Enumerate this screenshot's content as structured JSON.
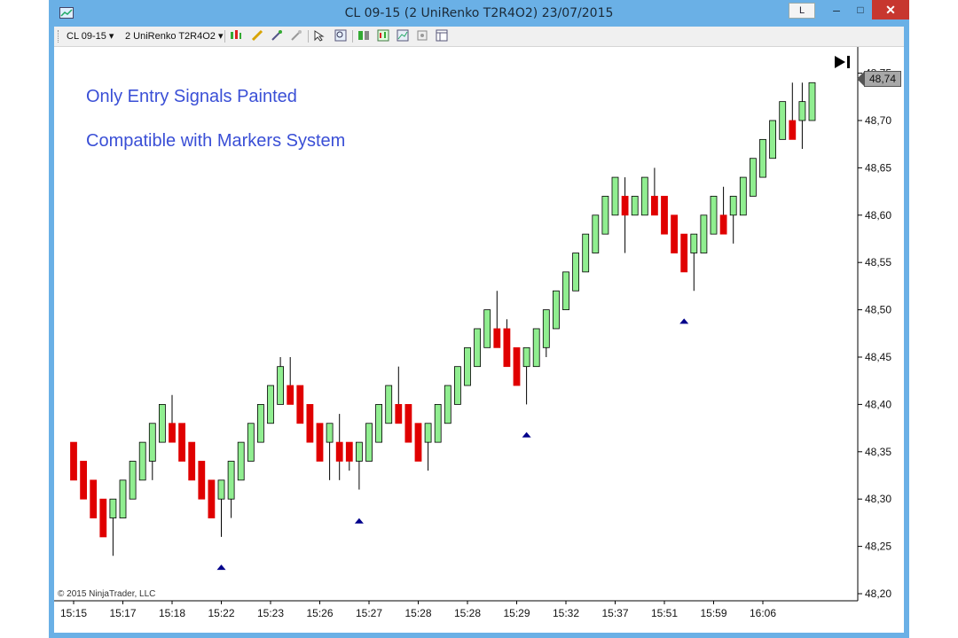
{
  "window": {
    "title": "CL 09-15 (2 UniRenko T2R4O2)  23/07/2015",
    "btn_l": "L",
    "btn_min": "–",
    "btn_max": "□",
    "btn_close": "✕"
  },
  "toolbar": {
    "instrument": "CL 09-15 ▾",
    "period": "2 UniRenko T2R4O2 ▾",
    "icons": [
      "bar-style-icon",
      "draw-pencil-icon",
      "indicator-add-icon",
      "strategy-icon",
      "cursor-select-icon",
      "zoom-icon",
      "data-box-icon",
      "chart-trader-icon",
      "properties-icon",
      "screenshot-icon",
      "template-icon"
    ]
  },
  "notes": {
    "line1": "Only Entry Signals Painted",
    "line2": "Compatible with Markers System"
  },
  "copyright": "© 2015 NinjaTrader, LLC",
  "price_tag": "48,74",
  "colors": {
    "up": "#90ee90",
    "down": "#e00000",
    "marker": "#00008b",
    "accent": "#3a4fd6"
  },
  "chart_data": {
    "type": "candlestick",
    "title": "",
    "ylim": [
      48.2,
      48.76
    ],
    "y_ticks": [
      "48,20",
      "48,25",
      "48,30",
      "48,35",
      "48,40",
      "48,45",
      "48,50",
      "48,55",
      "48,60",
      "48,65",
      "48,70",
      "48,75"
    ],
    "x_tick_labels": [
      "15:15",
      "15:17",
      "15:18",
      "15:22",
      "15:23",
      "15:26",
      "15:27",
      "15:28",
      "15:28",
      "15:29",
      "15:32",
      "15:37",
      "15:51",
      "15:59",
      "16:06"
    ],
    "candles": [
      {
        "o": 48.36,
        "c": 48.32,
        "h": 48.36,
        "l": 48.32
      },
      {
        "o": 48.34,
        "c": 48.3,
        "h": 48.34,
        "l": 48.3
      },
      {
        "o": 48.32,
        "c": 48.28,
        "h": 48.32,
        "l": 48.28
      },
      {
        "o": 48.3,
        "c": 48.26,
        "h": 48.3,
        "l": 48.26
      },
      {
        "o": 48.28,
        "c": 48.3,
        "h": 48.3,
        "l": 48.24
      },
      {
        "o": 48.28,
        "c": 48.32,
        "h": 48.32,
        "l": 48.28
      },
      {
        "o": 48.3,
        "c": 48.34,
        "h": 48.34,
        "l": 48.3
      },
      {
        "o": 48.32,
        "c": 48.36,
        "h": 48.36,
        "l": 48.32
      },
      {
        "o": 48.34,
        "c": 48.38,
        "h": 48.38,
        "l": 48.32
      },
      {
        "o": 48.36,
        "c": 48.4,
        "h": 48.4,
        "l": 48.36
      },
      {
        "o": 48.38,
        "c": 48.36,
        "h": 48.41,
        "l": 48.36
      },
      {
        "o": 48.38,
        "c": 48.34,
        "h": 48.38,
        "l": 48.34
      },
      {
        "o": 48.36,
        "c": 48.32,
        "h": 48.36,
        "l": 48.32
      },
      {
        "o": 48.34,
        "c": 48.3,
        "h": 48.34,
        "l": 48.3
      },
      {
        "o": 48.32,
        "c": 48.28,
        "h": 48.32,
        "l": 48.28
      },
      {
        "o": 48.3,
        "c": 48.32,
        "h": 48.32,
        "l": 48.26
      },
      {
        "o": 48.3,
        "c": 48.34,
        "h": 48.34,
        "l": 48.28
      },
      {
        "o": 48.32,
        "c": 48.36,
        "h": 48.36,
        "l": 48.32
      },
      {
        "o": 48.34,
        "c": 48.38,
        "h": 48.38,
        "l": 48.34
      },
      {
        "o": 48.36,
        "c": 48.4,
        "h": 48.4,
        "l": 48.36
      },
      {
        "o": 48.38,
        "c": 48.42,
        "h": 48.42,
        "l": 48.38
      },
      {
        "o": 48.4,
        "c": 48.44,
        "h": 48.45,
        "l": 48.4
      },
      {
        "o": 48.42,
        "c": 48.4,
        "h": 48.45,
        "l": 48.4
      },
      {
        "o": 48.42,
        "c": 48.38,
        "h": 48.42,
        "l": 48.38
      },
      {
        "o": 48.4,
        "c": 48.36,
        "h": 48.4,
        "l": 48.36
      },
      {
        "o": 48.38,
        "c": 48.34,
        "h": 48.38,
        "l": 48.34
      },
      {
        "o": 48.36,
        "c": 48.38,
        "h": 48.38,
        "l": 48.32
      },
      {
        "o": 48.36,
        "c": 48.34,
        "h": 48.39,
        "l": 48.32
      },
      {
        "o": 48.36,
        "c": 48.34,
        "h": 48.36,
        "l": 48.33
      },
      {
        "o": 48.34,
        "c": 48.36,
        "h": 48.36,
        "l": 48.31
      },
      {
        "o": 48.34,
        "c": 48.38,
        "h": 48.38,
        "l": 48.34
      },
      {
        "o": 48.36,
        "c": 48.4,
        "h": 48.4,
        "l": 48.36
      },
      {
        "o": 48.38,
        "c": 48.42,
        "h": 48.42,
        "l": 48.38
      },
      {
        "o": 48.4,
        "c": 48.38,
        "h": 48.44,
        "l": 48.38
      },
      {
        "o": 48.4,
        "c": 48.36,
        "h": 48.4,
        "l": 48.36
      },
      {
        "o": 48.38,
        "c": 48.34,
        "h": 48.38,
        "l": 48.34
      },
      {
        "o": 48.36,
        "c": 48.38,
        "h": 48.38,
        "l": 48.33
      },
      {
        "o": 48.36,
        "c": 48.4,
        "h": 48.4,
        "l": 48.36
      },
      {
        "o": 48.38,
        "c": 48.42,
        "h": 48.42,
        "l": 48.38
      },
      {
        "o": 48.4,
        "c": 48.44,
        "h": 48.44,
        "l": 48.4
      },
      {
        "o": 48.42,
        "c": 48.46,
        "h": 48.46,
        "l": 48.42
      },
      {
        "o": 48.44,
        "c": 48.48,
        "h": 48.48,
        "l": 48.44
      },
      {
        "o": 48.46,
        "c": 48.5,
        "h": 48.5,
        "l": 48.46
      },
      {
        "o": 48.48,
        "c": 48.46,
        "h": 48.52,
        "l": 48.46
      },
      {
        "o": 48.48,
        "c": 48.44,
        "h": 48.49,
        "l": 48.44
      },
      {
        "o": 48.46,
        "c": 48.42,
        "h": 48.46,
        "l": 48.42
      },
      {
        "o": 48.44,
        "c": 48.46,
        "h": 48.46,
        "l": 48.4
      },
      {
        "o": 48.44,
        "c": 48.48,
        "h": 48.48,
        "l": 48.44
      },
      {
        "o": 48.46,
        "c": 48.5,
        "h": 48.5,
        "l": 48.45
      },
      {
        "o": 48.48,
        "c": 48.52,
        "h": 48.52,
        "l": 48.48
      },
      {
        "o": 48.5,
        "c": 48.54,
        "h": 48.54,
        "l": 48.5
      },
      {
        "o": 48.52,
        "c": 48.56,
        "h": 48.56,
        "l": 48.52
      },
      {
        "o": 48.54,
        "c": 48.58,
        "h": 48.58,
        "l": 48.54
      },
      {
        "o": 48.56,
        "c": 48.6,
        "h": 48.6,
        "l": 48.56
      },
      {
        "o": 48.58,
        "c": 48.62,
        "h": 48.62,
        "l": 48.58
      },
      {
        "o": 48.6,
        "c": 48.64,
        "h": 48.64,
        "l": 48.6
      },
      {
        "o": 48.62,
        "c": 48.6,
        "h": 48.64,
        "l": 48.56
      },
      {
        "o": 48.6,
        "c": 48.62,
        "h": 48.62,
        "l": 48.6
      },
      {
        "o": 48.6,
        "c": 48.64,
        "h": 48.64,
        "l": 48.6
      },
      {
        "o": 48.62,
        "c": 48.6,
        "h": 48.65,
        "l": 48.6
      },
      {
        "o": 48.62,
        "c": 48.58,
        "h": 48.62,
        "l": 48.58
      },
      {
        "o": 48.6,
        "c": 48.56,
        "h": 48.6,
        "l": 48.56
      },
      {
        "o": 48.58,
        "c": 48.54,
        "h": 48.58,
        "l": 48.54
      },
      {
        "o": 48.56,
        "c": 48.58,
        "h": 48.58,
        "l": 48.52
      },
      {
        "o": 48.56,
        "c": 48.6,
        "h": 48.6,
        "l": 48.56
      },
      {
        "o": 48.58,
        "c": 48.62,
        "h": 48.62,
        "l": 48.58
      },
      {
        "o": 48.6,
        "c": 48.58,
        "h": 48.63,
        "l": 48.58
      },
      {
        "o": 48.6,
        "c": 48.62,
        "h": 48.62,
        "l": 48.57
      },
      {
        "o": 48.6,
        "c": 48.64,
        "h": 48.64,
        "l": 48.6
      },
      {
        "o": 48.62,
        "c": 48.66,
        "h": 48.66,
        "l": 48.62
      },
      {
        "o": 48.64,
        "c": 48.68,
        "h": 48.68,
        "l": 48.64
      },
      {
        "o": 48.66,
        "c": 48.7,
        "h": 48.7,
        "l": 48.66
      },
      {
        "o": 48.68,
        "c": 48.72,
        "h": 48.72,
        "l": 48.68
      },
      {
        "o": 48.7,
        "c": 48.68,
        "h": 48.74,
        "l": 48.68
      },
      {
        "o": 48.7,
        "c": 48.72,
        "h": 48.74,
        "l": 48.67
      },
      {
        "o": 48.7,
        "c": 48.74,
        "h": 48.74,
        "l": 48.7
      }
    ],
    "markers": [
      {
        "bar": 15,
        "price": 48.228
      },
      {
        "bar": 29,
        "price": 48.277
      },
      {
        "bar": 46,
        "price": 48.368
      },
      {
        "bar": 62,
        "price": 48.488
      }
    ],
    "last_price": 48.74,
    "grid": false
  }
}
